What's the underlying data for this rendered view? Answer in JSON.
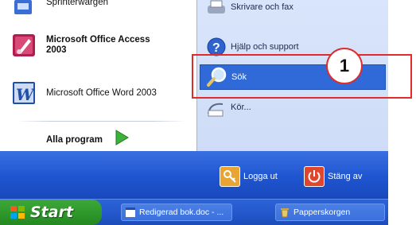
{
  "colors": {
    "menu_blue": "#2458cc",
    "start_green": "#2f9a2b",
    "selection": "#2f6ad8",
    "callout_red": "#e02b2b",
    "right_panel": "#d3e1f9"
  },
  "start_menu": {
    "left_programs": [
      {
        "label": "Sprinterwargen",
        "icon": "app-icon",
        "cut_off": true
      },
      {
        "label_line1": "Microsoft Office Access",
        "label_line2": "2003",
        "icon": "access-icon",
        "bold": true
      },
      {
        "label": "Microsoft Office Word 2003",
        "icon": "word-icon",
        "bold": false
      }
    ],
    "all_programs_label": "Alla program",
    "right_items": [
      {
        "label": "Skrivare och fax",
        "icon": "printer-icon",
        "cut_off": true
      },
      {
        "label": "Hjälp och support",
        "icon": "help-icon"
      },
      {
        "label": "Sök",
        "icon": "search-icon",
        "selected": true
      },
      {
        "label": "Kör...",
        "icon": "run-icon"
      }
    ],
    "logoff_label": "Logga ut",
    "shutdown_label": "Stäng av"
  },
  "callout": {
    "number": "1"
  },
  "taskbar": {
    "start_label": "Start",
    "buttons": [
      {
        "label": "Redigerad bok.doc - ...",
        "icon": "word-doc-icon"
      },
      {
        "label": "Papperskorgen",
        "icon": "recycle-bin-icon"
      }
    ]
  }
}
